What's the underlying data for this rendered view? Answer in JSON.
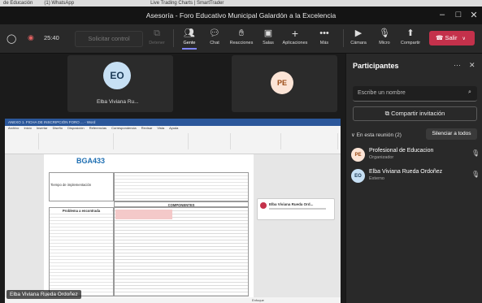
{
  "browser_tabs": [
    "de Educación",
    "(1) WhatsApp",
    "Live Trading Charts | SmartTrader"
  ],
  "window": {
    "title": "Asesoría - Foro Educativo Municipal Galardón a la Excelencia"
  },
  "toolbar": {
    "timer": "25:40",
    "control_request": "Solicitar control",
    "items": [
      {
        "label": "Detener"
      },
      {
        "label": "Gente"
      },
      {
        "label": "Chat"
      },
      {
        "label": "Reacciones"
      },
      {
        "label": "Salas"
      },
      {
        "label": "Aplicaciones"
      },
      {
        "label": "Más"
      },
      {
        "label": "Cámara"
      },
      {
        "label": "Micro"
      },
      {
        "label": "Compartir"
      }
    ],
    "leave": "Salir"
  },
  "stage": {
    "tiles": [
      {
        "initials": "EO",
        "name": "Elba Viviana Ru..."
      },
      {
        "initials": "PE",
        "name": ""
      }
    ],
    "presenter_label": "Elba Viviana Rueda Ordoñez"
  },
  "shared_document": {
    "menu": "Archivo Inicio Insertar Diseño Disposición Referencias Correspondencia Revisar Vista Ayuda",
    "logo": "BGA433",
    "table_header": "COMPONENTES",
    "cell_left_title": "Problema a encontrada",
    "cell_label": "Tiempo de implementación",
    "comment_author": "Elba Viviana Rueda Ord...",
    "status_bar": "Enfoque"
  },
  "panel": {
    "title": "Participantes",
    "search_placeholder": "Escribe un nombre",
    "invite": "Compartir invitación",
    "in_meeting": "En esta reunión (2)",
    "mute_all": "Silenciar a todos",
    "participants": [
      {
        "initials": "PE",
        "name": "Profesional de Educacion",
        "role": "Organizador"
      },
      {
        "initials": "EO",
        "name": "Elba Viviana Rueda Ordoñez",
        "role": "Externo"
      }
    ]
  },
  "colors": {
    "accent": "#7f85f5",
    "leave": "#c4314b",
    "word_blue": "#2b579a",
    "eo_avatar": "#c7e0f4",
    "pe_avatar": "#fce4d6"
  }
}
